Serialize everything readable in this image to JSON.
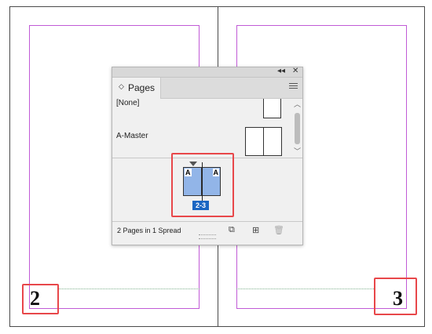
{
  "spread": {
    "left_page_number": "2",
    "right_page_number": "3"
  },
  "panel": {
    "controls": {
      "collapse": "◂◂",
      "close": "✕"
    },
    "tab": {
      "arrows": "◇",
      "label": "Pages"
    },
    "masters": [
      {
        "name": "[None]"
      },
      {
        "name": "A-Master"
      }
    ],
    "spread_thumb": {
      "left_master": "A",
      "right_master": "A",
      "label": "2-3"
    },
    "footer": {
      "status": "2 Pages in 1 Spread",
      "buttons": [
        "edit-page-size-icon",
        "new-page-icon",
        "delete-page-icon"
      ]
    }
  },
  "colors": {
    "margin_guide": "#c15ad6",
    "highlight": "#e8474a",
    "selected_spread": "#1a66c2",
    "thumb_fill": "#92b5e8"
  }
}
